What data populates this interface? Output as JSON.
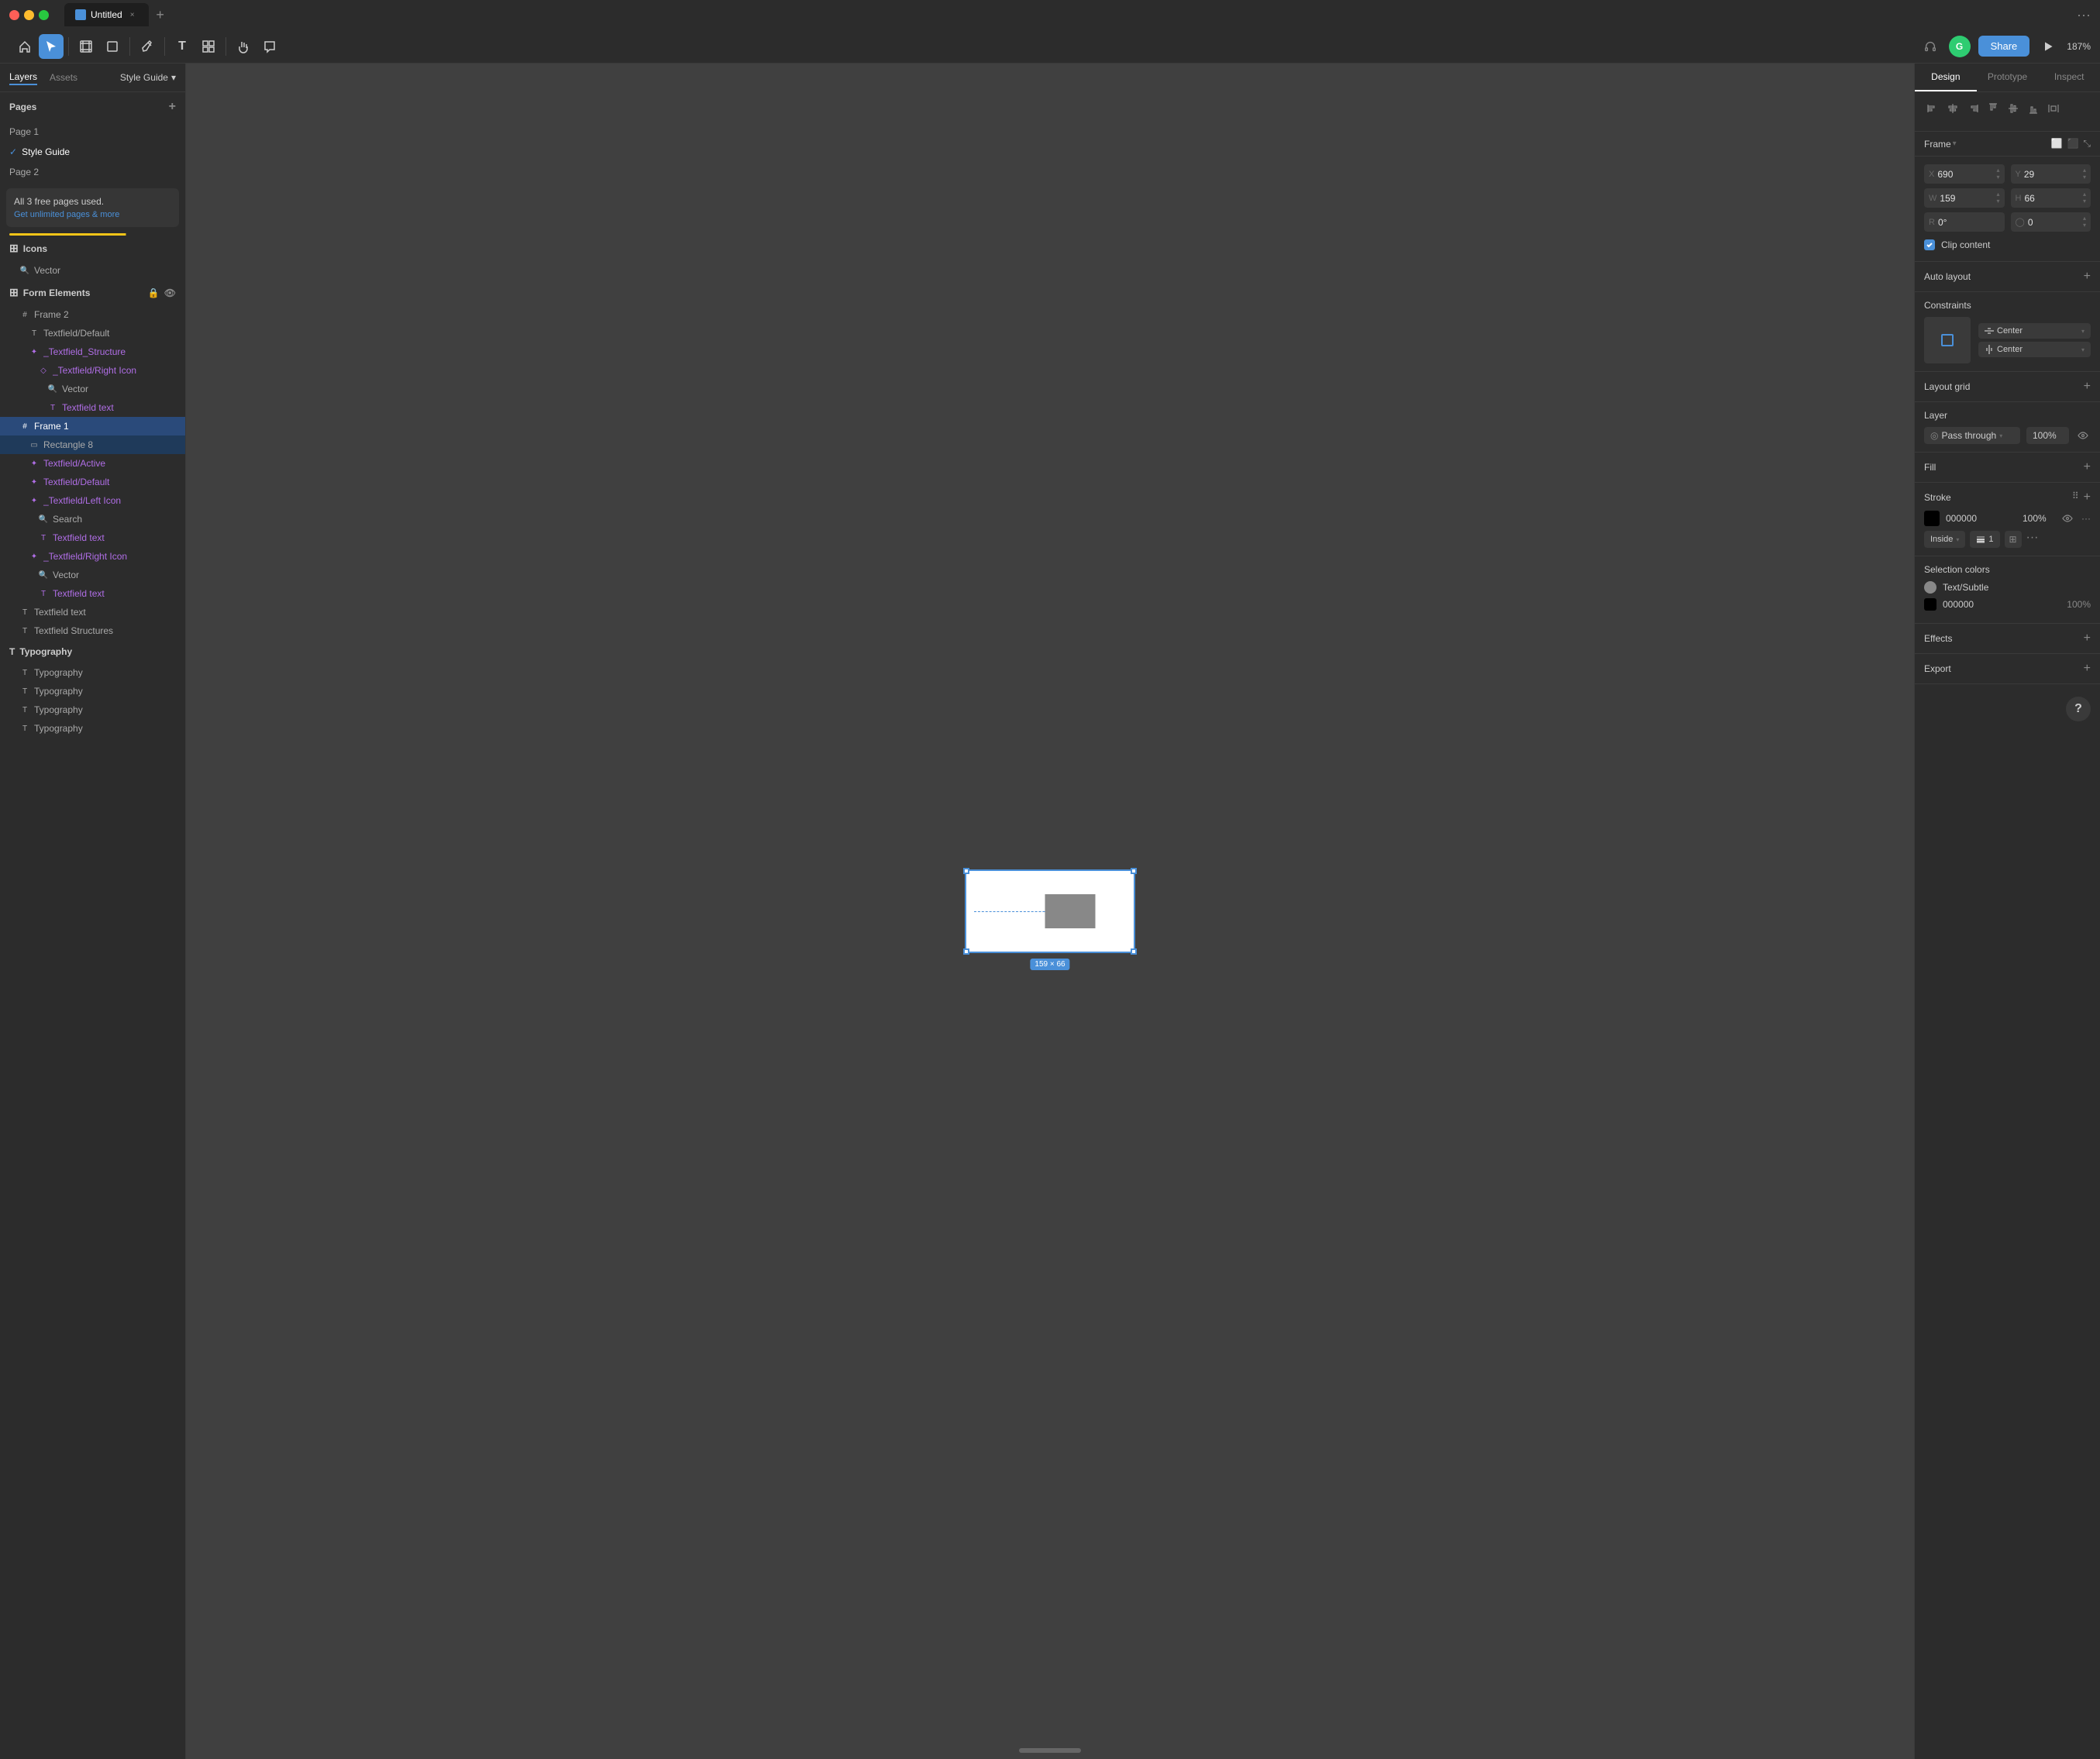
{
  "titleBar": {
    "appTitle": "Untitled",
    "tabLabel": "Untitled",
    "newTabLabel": "+",
    "moreLabel": "···"
  },
  "toolbar": {
    "tools": [
      {
        "name": "home",
        "icon": "⌂",
        "active": false
      },
      {
        "name": "select",
        "icon": "▲",
        "active": true
      },
      {
        "name": "frame",
        "icon": "⊞",
        "active": false
      },
      {
        "name": "shape",
        "icon": "□",
        "active": false
      },
      {
        "name": "pen",
        "icon": "✒",
        "active": false
      },
      {
        "name": "text",
        "icon": "T",
        "active": false
      },
      {
        "name": "component",
        "icon": "⧉",
        "active": false
      },
      {
        "name": "hand",
        "icon": "✋",
        "active": false
      },
      {
        "name": "comment",
        "icon": "💬",
        "active": false
      }
    ],
    "zoomLevel": "187%",
    "shareLabel": "Share",
    "avatarInitial": "G"
  },
  "leftPanel": {
    "tabs": {
      "layers": "Layers",
      "assets": "Assets",
      "styleGuide": "Style Guide"
    },
    "pages": {
      "header": "Pages",
      "items": [
        {
          "label": "Page 1",
          "active": false
        },
        {
          "label": "Style Guide",
          "active": true,
          "checked": true
        },
        {
          "label": "Page 2",
          "active": false
        }
      ]
    },
    "upgradeBar": {
      "title": "All 3 free pages used.",
      "linkText": "Get unlimited pages & more"
    },
    "sections": [
      {
        "name": "Icons",
        "items": [
          {
            "label": "Vector",
            "icon": "search",
            "indent": 1
          }
        ]
      },
      {
        "name": "Form Elements",
        "items": [
          {
            "label": "Frame 2",
            "icon": "frame",
            "indent": 1
          },
          {
            "label": "Textfield/Default",
            "icon": "text",
            "indent": 2
          },
          {
            "label": "_Textfield_Structure",
            "icon": "component",
            "indent": 2,
            "color": "purple"
          },
          {
            "label": "_Textfield/Right Icon",
            "icon": "diamond",
            "indent": 3,
            "color": "purple"
          },
          {
            "label": "Vector",
            "icon": "search",
            "indent": 4
          },
          {
            "label": "Textfield text",
            "icon": "text",
            "indent": 4
          },
          {
            "label": "Frame 1",
            "icon": "frame",
            "indent": 1,
            "selected": true
          },
          {
            "label": "Rectangle 8",
            "icon": "rect",
            "indent": 2
          },
          {
            "label": "Textfield/Active",
            "icon": "component",
            "indent": 2,
            "color": "purple"
          },
          {
            "label": "Textfield/Default",
            "icon": "component",
            "indent": 2,
            "color": "purple"
          },
          {
            "label": "_Textfield/Left Icon",
            "icon": "component",
            "indent": 2,
            "color": "purple"
          },
          {
            "label": "Search",
            "icon": "search",
            "indent": 3
          },
          {
            "label": "Textfield text",
            "icon": "text",
            "indent": 3
          },
          {
            "label": "_Textfield/Right Icon",
            "icon": "component",
            "indent": 2,
            "color": "purple"
          },
          {
            "label": "Vector",
            "icon": "search",
            "indent": 3
          },
          {
            "label": "Textfield text",
            "icon": "text",
            "indent": 3
          },
          {
            "label": "Textfield text",
            "icon": "text",
            "indent": 1
          },
          {
            "label": "Textfield Structures",
            "icon": "text",
            "indent": 1
          }
        ]
      },
      {
        "name": "Typography",
        "items": [
          {
            "label": "Typography",
            "icon": "text",
            "indent": 0
          },
          {
            "label": "Typography",
            "icon": "text",
            "indent": 0
          },
          {
            "label": "Typography",
            "icon": "text",
            "indent": 0
          },
          {
            "label": "Typography",
            "icon": "text",
            "indent": 0
          }
        ]
      }
    ]
  },
  "canvas": {
    "frameDimensions": "159 × 66"
  },
  "rightPanel": {
    "tabs": [
      "Design",
      "Prototype",
      "Inspect"
    ],
    "activeTab": "Design",
    "frame": {
      "label": "Frame",
      "x": "690",
      "y": "29",
      "w": "159",
      "h": "66",
      "r": "0°",
      "corner": "0"
    },
    "clipContent": "Clip content",
    "autoLayout": "Auto layout",
    "constraints": {
      "header": "Constraints",
      "horizontal": "Center",
      "vertical": "Center"
    },
    "layoutGrid": "Layout grid",
    "layer": {
      "header": "Layer",
      "blendMode": "Pass through",
      "opacity": "100%",
      "eyeVisible": true
    },
    "fill": {
      "header": "Fill"
    },
    "stroke": {
      "header": "Stroke",
      "color": "000000",
      "opacity": "100%",
      "align": "Inside",
      "size": "1"
    },
    "selectionColors": {
      "header": "Selection colors",
      "items": [
        {
          "label": "Text/Subtle",
          "color": "#888",
          "isCircle": true
        },
        {
          "label": "000000",
          "color": "#000",
          "opacity": "100%",
          "isCircle": false
        }
      ]
    },
    "effects": {
      "label": "Effects"
    },
    "export": {
      "label": "Export"
    }
  }
}
